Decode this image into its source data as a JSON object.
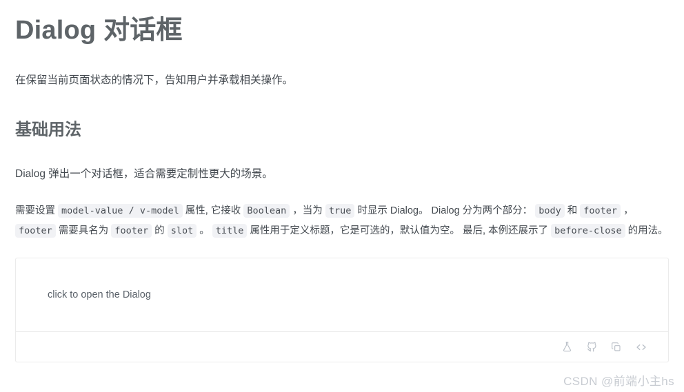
{
  "page": {
    "title": "Dialog 对话框",
    "lead": "在保留当前页面状态的情况下，告知用户并承载相关操作。"
  },
  "section": {
    "heading": "基础用法",
    "intro": "Dialog 弹出一个对话框，适合需要定制性更大的场景。",
    "description": {
      "t1": "需要设置",
      "c1": "model-value / v-model",
      "t2": "属性, 它接收",
      "c2": "Boolean",
      "t3": "，当为",
      "c3": "true",
      "t4": "时显示 Dialog。 Dialog 分为两个部分：",
      "c4": "body",
      "t5": "和",
      "c5": "footer",
      "t6": "，",
      "c6": "footer",
      "t7": "需要具名为",
      "c7": "footer",
      "t8": "的",
      "c8": "slot",
      "t9": "。",
      "c9": "title",
      "t10": "属性用于定义标题，它是可选的，默认值为空。 最后, 本例还展示了",
      "c10": "before-close",
      "t11": "的用法。"
    }
  },
  "demo": {
    "open_button_label": "click to open the Dialog",
    "actions": [
      {
        "name": "flask-icon",
        "title": "在 Codepen 中编辑"
      },
      {
        "name": "github-icon",
        "title": "在 Github 中查看"
      },
      {
        "name": "copy-icon",
        "title": "复制代码"
      },
      {
        "name": "code-icon",
        "title": "查看源代码"
      }
    ]
  },
  "watermark": {
    "text": "CSDN @前端小主hs"
  },
  "colors": {
    "heading": "#5e6468",
    "body_text": "#444a50",
    "chip_bg": "#f1f2f5",
    "chip_text": "#4a4f55",
    "border": "#ebebeb",
    "icon": "#b9bfc7",
    "watermark": "#c8ccd2"
  }
}
